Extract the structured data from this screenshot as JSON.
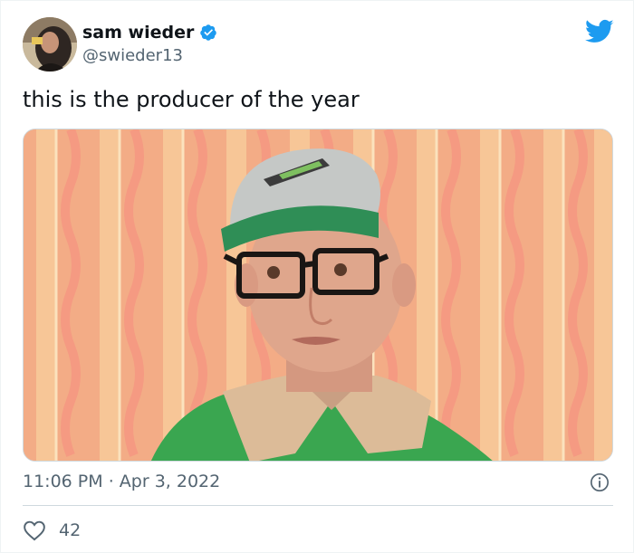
{
  "tweet": {
    "author": {
      "name": "sam wieder",
      "handle": "@swieder13",
      "verified": true
    },
    "text": "this is the producer of the year",
    "timestamp": "11:06 PM",
    "separator": "·",
    "date": "Apr 3, 2022",
    "likes": "42"
  },
  "icons": {
    "brand": "twitter-bird-icon",
    "verified": "verified-badge-icon",
    "info": "info-icon",
    "like": "heart-icon"
  },
  "colors": {
    "twitter_blue": "#1d9bf0",
    "text_primary": "#0f1419",
    "text_secondary": "#536471",
    "divider": "#cfd9de",
    "media_wallpaper": "#f3a983"
  }
}
